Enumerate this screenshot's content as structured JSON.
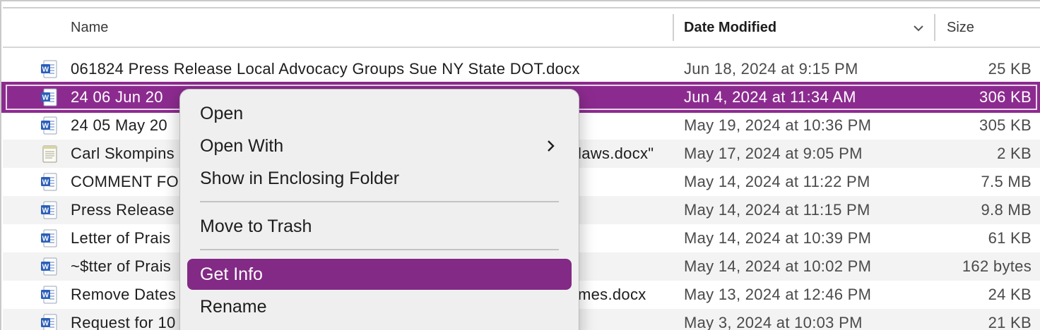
{
  "columns": {
    "name": "Name",
    "date_modified": "Date Modified",
    "size": "Size"
  },
  "files": [
    {
      "name": "061824 Press Release Local Advocacy Groups Sue NY State DOT.docx",
      "name_tail": "",
      "date": "Jun 18, 2024 at 9:15 PM",
      "size": "25 KB",
      "icon": "word-doc-icon"
    },
    {
      "name": "24 06 Jun 20",
      "name_tail": "",
      "date": "Jun 4, 2024 at 11:34 AM",
      "size": "306 KB",
      "icon": "word-doc-icon"
    },
    {
      "name": "24 05 May 20",
      "name_tail": "",
      "date": "May 19, 2024 at 10:36 PM",
      "size": "305 KB",
      "icon": "word-doc-icon"
    },
    {
      "name": "Carl Skompins",
      "name_tail": "laws.docx\"",
      "date": "May 17, 2024 at 9:05 PM",
      "size": "2 KB",
      "icon": "text-doc-icon"
    },
    {
      "name": "COMMENT FO",
      "name_tail": "",
      "date": "May 14, 2024 at 11:22 PM",
      "size": "7.5 MB",
      "icon": "word-doc-icon"
    },
    {
      "name": "Press Release",
      "name_tail": "",
      "date": "May 14, 2024 at 11:15 PM",
      "size": "9.8 MB",
      "icon": "word-doc-icon"
    },
    {
      "name": "Letter of Prais",
      "name_tail": "",
      "date": "May 14, 2024 at 10:39 PM",
      "size": "61 KB",
      "icon": "word-doc-icon"
    },
    {
      "name": "~$tter of Prais",
      "name_tail": "",
      "date": "May 14, 2024 at 10:02 PM",
      "size": "162 bytes",
      "icon": "word-doc-icon"
    },
    {
      "name": "Remove Dates",
      "name_tail": "mes.docx",
      "date": "May 13, 2024 at 12:46 PM",
      "size": "24 KB",
      "icon": "word-doc-icon"
    },
    {
      "name": "Request for 10",
      "name_tail": "",
      "date": "May 3, 2024 at 10:03 PM",
      "size": "21 KB",
      "icon": "word-doc-icon"
    }
  ],
  "context_menu": {
    "items": [
      {
        "label": "Open"
      },
      {
        "label": "Open With"
      },
      {
        "label": "Show in Enclosing Folder"
      },
      {
        "label": "Move to Trash"
      },
      {
        "label": "Get Info"
      },
      {
        "label": "Rename"
      }
    ],
    "highlighted": "Get Info"
  },
  "colors": {
    "selection": "#8c2b8f",
    "menu_highlight": "#822a85",
    "word_blue": "#2b5fb8"
  }
}
